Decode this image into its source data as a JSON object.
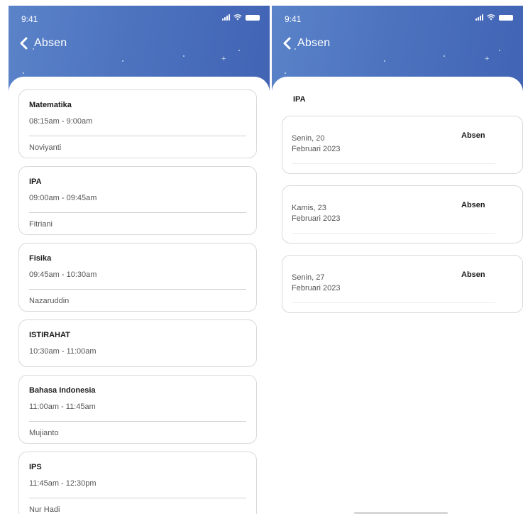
{
  "status_bar": {
    "time": "9:41"
  },
  "left": {
    "nav": {
      "back_label": "Absen"
    },
    "schedule": [
      {
        "subject": "Matematika",
        "time": "08:15am - 9:00am",
        "teacher": "Noviyanti"
      },
      {
        "subject": "IPA",
        "time": "09:00am - 09:45am",
        "teacher": "Fitriani"
      },
      {
        "subject": "Fisika",
        "time": "09:45am - 10:30am",
        "teacher": "Nazaruddin"
      },
      {
        "subject": "ISTIRAHAT",
        "time": "10:30am - 11:00am"
      },
      {
        "subject": "Bahasa Indonesia",
        "time": "11:00am - 11:45am",
        "teacher": "Mujianto"
      },
      {
        "subject": "IPS",
        "time": "11:45am - 12:30pm",
        "teacher": "Nur Hadi"
      }
    ]
  },
  "right": {
    "nav": {
      "back_label": "Absen"
    },
    "subject": "IPA",
    "attendance": [
      {
        "date": "Senin, 20\nFebruari 2023",
        "action": "Absen"
      },
      {
        "date": "Kamis, 23\nFebruari 2023",
        "action": "Absen"
      },
      {
        "date": "Senin, 27\nFebruari 2023",
        "action": "Absen"
      }
    ]
  },
  "theme": {
    "header_start": "#5a83c9",
    "header_end": "#4164b4",
    "card_border": "#d9d9d9"
  }
}
